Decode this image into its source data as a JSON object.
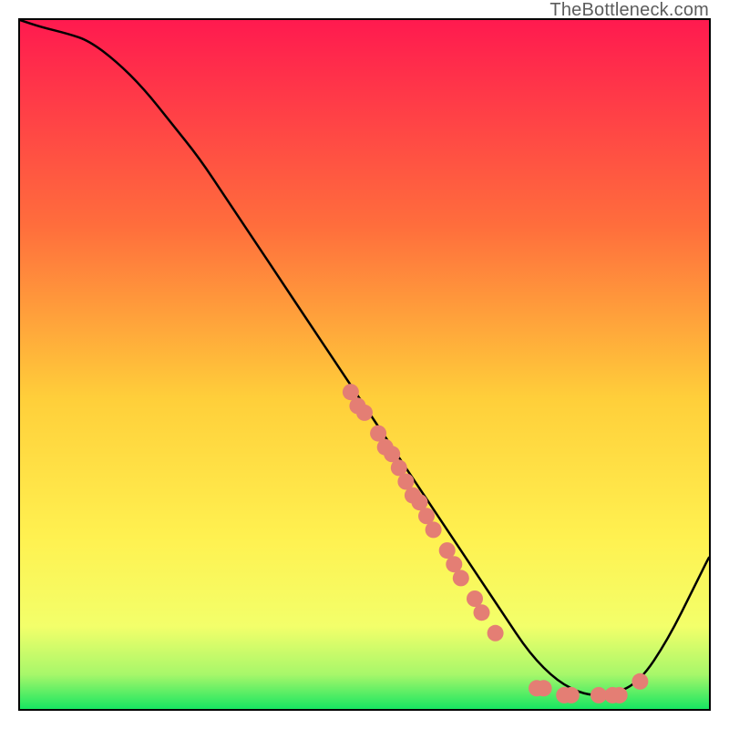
{
  "attribution": "TheBottleneck.com",
  "colors": {
    "gradient_top": "#ff1a4f",
    "gradient_mid1": "#ff7a3a",
    "gradient_mid2": "#ffe23a",
    "gradient_mid3": "#fff95a",
    "gradient_bottom": "#17e661",
    "curve": "#000000",
    "dot_fill": "#e47e74",
    "dot_stroke": "#b35148",
    "border": "#000000"
  },
  "chart_data": {
    "type": "line",
    "title": "",
    "xlabel": "",
    "ylabel": "",
    "xlim": [
      0,
      100
    ],
    "ylim": [
      0,
      100
    ],
    "series": [
      {
        "name": "bottleneck-curve",
        "x": [
          0,
          3,
          7,
          10,
          14,
          18,
          22,
          26,
          30,
          34,
          38,
          42,
          46,
          50,
          54,
          58,
          62,
          66,
          70,
          74,
          78,
          82,
          86,
          90,
          94,
          98,
          100
        ],
        "y": [
          100,
          99,
          98,
          97,
          94,
          90,
          85,
          80,
          74,
          68,
          62,
          56,
          50,
          44,
          38,
          32,
          26,
          20,
          14,
          8,
          4,
          2,
          2,
          4,
          10,
          18,
          22
        ]
      }
    ],
    "clusters": [
      {
        "name": "mid-slope-cluster",
        "points": [
          {
            "x": 48,
            "y": 46
          },
          {
            "x": 49,
            "y": 44
          },
          {
            "x": 50,
            "y": 43
          },
          {
            "x": 52,
            "y": 40
          },
          {
            "x": 53,
            "y": 38
          },
          {
            "x": 54,
            "y": 37
          },
          {
            "x": 55,
            "y": 35
          },
          {
            "x": 56,
            "y": 33
          },
          {
            "x": 57,
            "y": 31
          },
          {
            "x": 58,
            "y": 30
          },
          {
            "x": 59,
            "y": 28
          },
          {
            "x": 60,
            "y": 26
          },
          {
            "x": 62,
            "y": 23
          },
          {
            "x": 63,
            "y": 21
          },
          {
            "x": 64,
            "y": 19
          },
          {
            "x": 66,
            "y": 16
          },
          {
            "x": 67,
            "y": 14
          },
          {
            "x": 69,
            "y": 11
          }
        ]
      },
      {
        "name": "valley-cluster",
        "points": [
          {
            "x": 75,
            "y": 3
          },
          {
            "x": 76,
            "y": 3
          },
          {
            "x": 79,
            "y": 2
          },
          {
            "x": 80,
            "y": 2
          },
          {
            "x": 84,
            "y": 2
          },
          {
            "x": 86,
            "y": 2
          },
          {
            "x": 87,
            "y": 2
          },
          {
            "x": 90,
            "y": 4
          }
        ]
      }
    ],
    "annotations": []
  }
}
